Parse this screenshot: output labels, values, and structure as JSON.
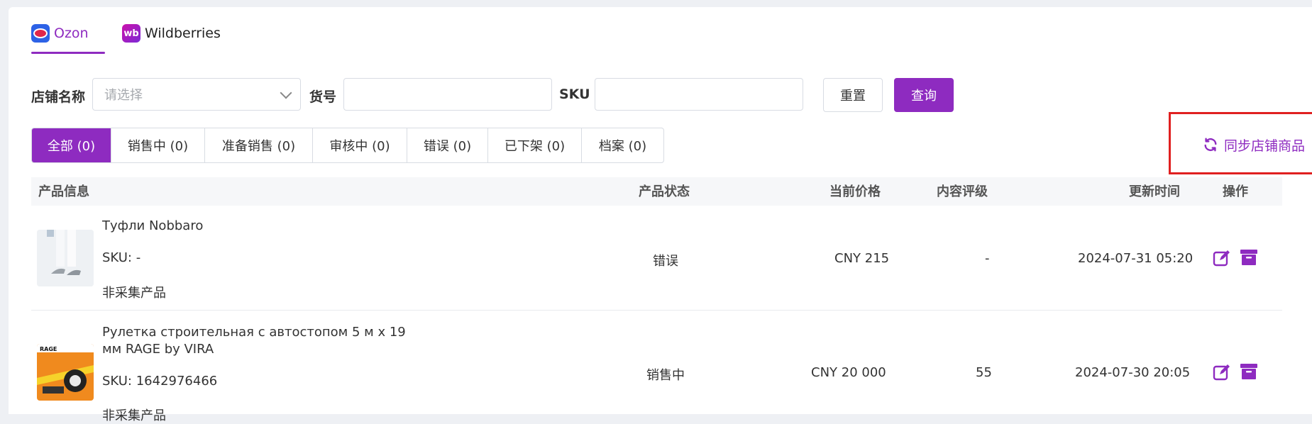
{
  "platform_tabs": [
    {
      "label": "Ozon",
      "active": true
    },
    {
      "label": "Wildberries",
      "active": false
    }
  ],
  "filters": {
    "store_label": "店铺名称",
    "store_placeholder": "请选择",
    "item_no_label": "货号",
    "item_no_value": "",
    "sku_label": "SKU",
    "sku_value": "",
    "reset_label": "重置",
    "query_label": "查询"
  },
  "status_tabs": [
    {
      "label": "全部 (0)",
      "active": true
    },
    {
      "label": "销售中 (0)",
      "active": false
    },
    {
      "label": "准备销售 (0)",
      "active": false
    },
    {
      "label": "审核中 (0)",
      "active": false
    },
    {
      "label": "错误 (0)",
      "active": false
    },
    {
      "label": "已下架 (0)",
      "active": false
    },
    {
      "label": "档案 (0)",
      "active": false
    }
  ],
  "sync_label": "同步店铺商品",
  "table": {
    "columns": [
      "产品信息",
      "产品状态",
      "当前价格",
      "内容评级",
      "更新时间",
      "操作"
    ],
    "rows": [
      {
        "title": "Туфли Nobbaro",
        "sku": "SKU: -",
        "source": "非采集产品",
        "status": "错误",
        "price": "CNY 215",
        "rating": "-",
        "updated": "2024-07-31 05:20"
      },
      {
        "title_line1": "Рулетка строительная с автостопом 5 м х 19",
        "title_line2": "мм RAGE by VIRA",
        "sku": "SKU: 1642976466",
        "source": "非采集产品",
        "status": "销售中",
        "price": "CNY 20 000",
        "rating": "55",
        "updated": "2024-07-30 20:05"
      }
    ]
  },
  "icons": {
    "edit": "edit-icon",
    "archive": "archive-icon",
    "sync": "sync-icon",
    "chevron": "chevron-down-icon"
  },
  "colors": {
    "accent": "#8e2bc0",
    "highlight_box": "#e02020"
  }
}
